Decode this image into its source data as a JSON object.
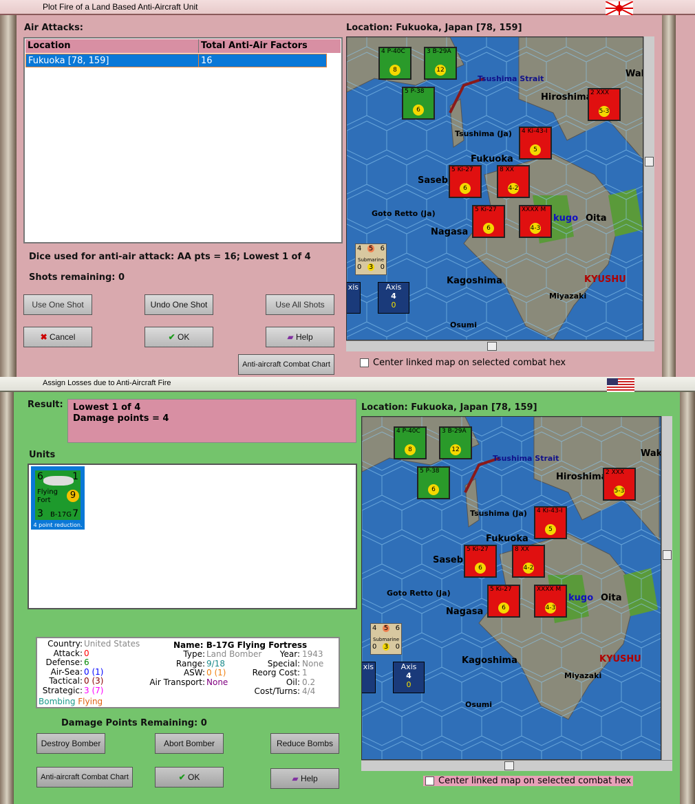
{
  "top": {
    "title": "Plot Fire of a Land Based Anti-Aircraft Unit",
    "air_attacks_label": "Air Attacks:",
    "table": {
      "headers": [
        "Location",
        "Total Anti-Air Factors"
      ],
      "rows": [
        [
          "Fukuoka  [78, 159]",
          "16"
        ]
      ]
    },
    "dice_text": "Dice used for anti-air attack:  AA pts = 16; Lowest 1 of 4",
    "shots_text": "Shots remaining:  0",
    "buttons": {
      "use_one": "Use One Shot",
      "undo_one": "Undo One Shot",
      "use_all": "Use All Shots",
      "cancel": "Cancel",
      "ok": "OK",
      "help": "Help",
      "chart": "Anti-aircraft Combat Chart"
    },
    "location": "Location: Fukuoka, Japan [78, 159]",
    "center_label": "Center linked map on selected combat hex"
  },
  "bottom": {
    "title": "Assign Losses due to Anti-Aircraft Fire",
    "result_label": "Result:",
    "result_lines": [
      "Lowest 1 of 4",
      "Damage points = 4"
    ],
    "units_label": "Units",
    "unit": {
      "att": "6",
      "def": "1",
      "name1": "Flying",
      "name2": "Fort",
      "bomb": "9",
      "bl": "3",
      "type": "B-17G",
      "br": "7",
      "caption": "4 point reduction."
    },
    "info": {
      "country_k": "Country:",
      "country_v": "United States",
      "attack_k": "Attack:",
      "attack_v": "0",
      "defense_k": "Defense:",
      "defense_v": "6",
      "airsea_k": "Air-Sea:",
      "airsea_v": "0 (1)",
      "tactical_k": "Tactical:",
      "tactical_v": "0 (3)",
      "strategic_k": "Strategic:",
      "strategic_v": "3 (7)",
      "bombing": "Bombing",
      "flying": "Flying",
      "name": "Name: B-17G Flying Fortress",
      "type_k": "Type:",
      "type_v": "Land Bomber",
      "range_k": "Range:",
      "range_v": "9/18",
      "asw_k": "ASW:",
      "asw_v": "0 (1)",
      "airtr_k": "Air Transport:",
      "airtr_v": "None",
      "year_k": "Year:",
      "year_v": "1943",
      "special_k": "Special:",
      "special_v": "None",
      "reorg_k": "Reorg Cost:",
      "reorg_v": "1",
      "oil_k": "Oil:",
      "oil_v": "0.2",
      "cost_k": "Cost/Turns:",
      "cost_v": "4/4"
    },
    "damage_text": "Damage Points Remaining:  0",
    "buttons": {
      "destroy": "Destroy Bomber",
      "abort": "Abort Bomber",
      "reduce": "Reduce Bombs",
      "chart": "Anti-aircraft Combat Chart",
      "ok": "OK",
      "help": "Help"
    },
    "location": "Location:  Fukuoka, Japan [78, 159]",
    "center_label": "Center linked map on selected combat hex"
  },
  "map": {
    "labels": [
      {
        "t": "Tsushima Strait",
        "c": "#10108a"
      },
      {
        "t": "Hiroshima",
        "c": "#000"
      },
      {
        "t": "Tsushima (Ja)",
        "c": "#000"
      },
      {
        "t": "Fukuoka",
        "c": "#000"
      },
      {
        "t": "Saseb",
        "c": "#000"
      },
      {
        "t": "Goto Retto (Ja)",
        "c": "#000"
      },
      {
        "t": "Nagasa",
        "c": "#000"
      },
      {
        "t": "Oita",
        "c": "#000"
      },
      {
        "t": "kugo",
        "c": "#1010c0"
      },
      {
        "t": "KYUSHU",
        "c": "#b00000"
      },
      {
        "t": "Kagoshima",
        "c": "#000"
      },
      {
        "t": "Miyazaki",
        "c": "#000"
      },
      {
        "t": "Osumi",
        "c": "#000"
      },
      {
        "t": "Wak",
        "c": "#000"
      }
    ],
    "counters": [
      {
        "top": "4",
        "name": "P-40C",
        "n": "8",
        "col": "#2a9a2a"
      },
      {
        "top": "3",
        "name": "B-29A",
        "n": "12",
        "col": "#2a9a2a"
      },
      {
        "top": "5",
        "name": "P-38",
        "n": "6",
        "col": "#2a9a2a"
      },
      {
        "top": "2",
        "name": "XXX",
        "n": "5-3",
        "col": "#e01010"
      },
      {
        "top": "4",
        "name": "Ki-43-I",
        "n": "5",
        "col": "#e01010"
      },
      {
        "top": "5",
        "name": "Ki-27",
        "n": "6",
        "col": "#e01010"
      },
      {
        "top": "8",
        "name": "XX",
        "n": "4-2",
        "col": "#e01010"
      },
      {
        "top": "5",
        "name": "Ki-27",
        "n": "6",
        "col": "#e01010"
      },
      {
        "top": "XXXX",
        "name": "M",
        "n": "4-3",
        "col": "#e01010"
      }
    ],
    "sub": {
      "a": "4",
      "b": "5",
      "c": "6",
      "name": "Submarine",
      "d": "0",
      "e": "3",
      "f": "0"
    },
    "axis": {
      "label": "Axis",
      "v1": "4",
      "v2": "0",
      "left": "xis"
    }
  },
  "colors": {
    "pink": "#d9a9ae",
    "green": "#74c46c",
    "select": "#0a78d7",
    "sea": "#2f6fb8"
  }
}
